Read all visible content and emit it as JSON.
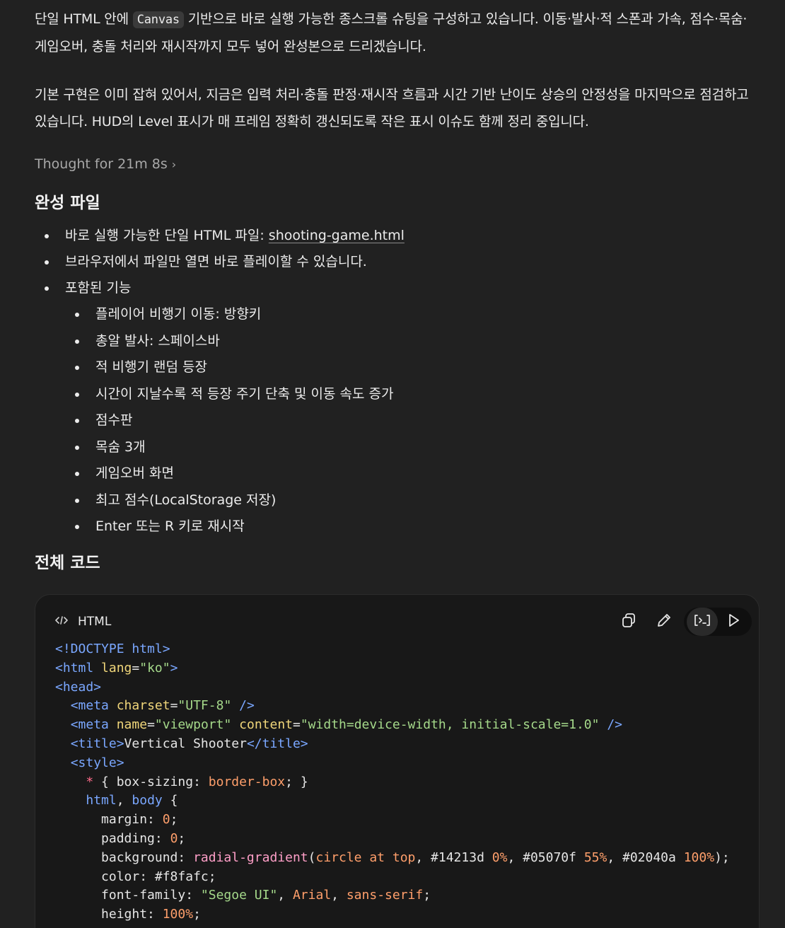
{
  "intro": {
    "para1_before": "단일 HTML 안에 ",
    "para1_code": "Canvas",
    "para1_after": " 기반으로 바로 실행 가능한 종스크롤 슈팅을 구성하고 있습니다. 이동·발사·적 스폰과 가속, 점수·목숨·게임오버, 충돌 처리와 재시작까지 모두 넣어 완성본으로 드리겠습니다.",
    "para2": "기본 구현은 이미 잡혀 있어서, 지금은 입력 처리·충돌 판정·재시작 흐름과 시간 기반 난이도 상승의 안정성을 마지막으로 점검하고 있습니다. HUD의 Level 표시가 매 프레임 정확히 갱신되도록 작은 표시 이슈도 함께 정리 중입니다."
  },
  "thought": {
    "label": "Thought for 21m 8s",
    "chevron": "›"
  },
  "section1": {
    "title": "완성 파일",
    "item1_prefix": "바로 실행 가능한 단일 HTML 파일: ",
    "item1_link": "shooting-game.html",
    "item2": "브라우저에서 파일만 열면 바로 플레이할 수 있습니다.",
    "item3": "포함된 기능",
    "features": [
      "플레이어 비행기 이동: 방향키",
      "총알 발사: 스페이스바",
      "적 비행기 랜덤 등장",
      "시간이 지날수록 적 등장 주기 단축 및 이동 속도 증가",
      "점수판",
      "목숨 3개",
      "게임오버 화면",
      "최고 점수(LocalStorage 저장)",
      "Enter 또는 R 키로 재시작"
    ]
  },
  "section2": {
    "title": "전체 코드"
  },
  "code_block": {
    "language": "HTML",
    "icons": [
      "code-icon",
      "copy-icon",
      "edit-icon",
      "run-console-icon",
      "play-icon"
    ],
    "lines": [
      "<!DOCTYPE html>",
      "<html lang=\"ko\">",
      "<head>",
      "  <meta charset=\"UTF-8\" />",
      "  <meta name=\"viewport\" content=\"width=device-width, initial-scale=1.0\" />",
      "  <title>Vertical Shooter</title>",
      "  <style>",
      "    * { box-sizing: border-box; }",
      "    html, body {",
      "      margin: 0;",
      "      padding: 0;",
      "      background: radial-gradient(circle at top, #14213d 0%, #05070f 55%, #02040a 100%);",
      "      color: #f8fafc;",
      "      font-family: \"Segoe UI\", Arial, sans-serif;",
      "      height: 100%;"
    ]
  },
  "colors": {
    "background": "#212121",
    "code_bg": "#181818",
    "tag": "#7aa7ff",
    "attr": "#f0d67a",
    "string": "#a5d98a",
    "keyword": "#ff9f6b"
  }
}
